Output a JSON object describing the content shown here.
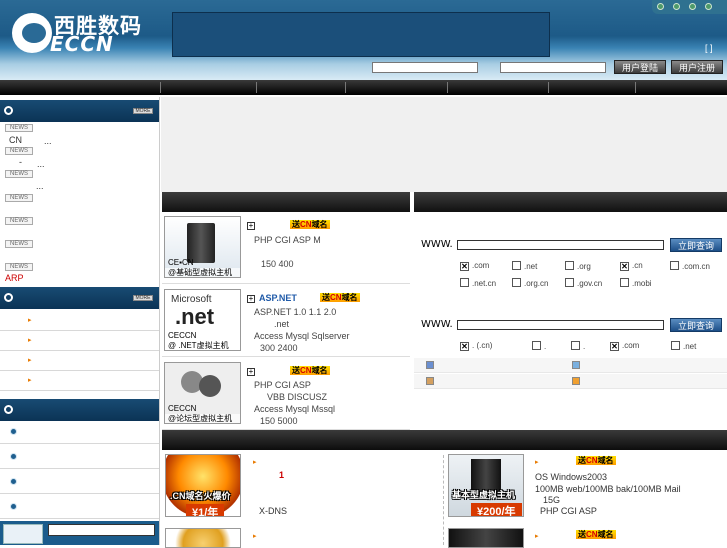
{
  "header": {
    "logo_cn": "西胜数码",
    "logo_en": "ECCN",
    "bracket_text": "[ ]",
    "login_button": "用户登陆",
    "register_button": "用户注册"
  },
  "sidebar": {
    "news_tag": "NEWS",
    "more_tag": "MORE",
    "news_lines": [
      "CN",
      "...",
      "-",
      "...",
      "...",
      "ARP"
    ]
  },
  "hosting": {
    "send_prefix": "送",
    "send_cn": "CN",
    "send_suffix": "域名",
    "items": [
      {
        "caption1": "CE▪CN",
        "caption2": "@基础型虚拟主机",
        "line1": "PHP CGI ASP  M",
        "line2": "150 400"
      },
      {
        "title": "ASP.NET",
        "caption1": "CECCN",
        "caption2": "@ .NET虚拟主机",
        "net_logo": "Microsoft",
        "net_big": ".net",
        "line1": "ASP.NET 1.0 1.1 2.0",
        "line2": ".net",
        "line3": "Access Mysql Sqlserver",
        "line4": "300 2400"
      },
      {
        "caption1": "CECCN",
        "caption2": "@论坛型虚拟主机",
        "line1": "PHP CGI ASP",
        "line2": "VBB DISCUSZ",
        "line3": "Access Mysql Mssql",
        "line4": "150 5000"
      }
    ]
  },
  "domain": {
    "www_label": "WWW.",
    "query_button": "立即查询",
    "tlds_row1": [
      {
        "label": ".com",
        "checked": true
      },
      {
        "label": ".net",
        "checked": false
      },
      {
        "label": ".org",
        "checked": false
      },
      {
        "label": ".cn",
        "checked": true
      },
      {
        "label": ".com.cn",
        "checked": false
      }
    ],
    "tlds_row2": [
      {
        "label": ".net.cn",
        "checked": false
      },
      {
        "label": ".org.cn",
        "checked": false
      },
      {
        "label": ".gov.cn",
        "checked": false
      },
      {
        "label": ".mobi",
        "checked": false
      }
    ],
    "tlds_row3": [
      {
        "label": ". (.cn)",
        "checked": true
      },
      {
        "label": ".",
        "checked": false
      },
      {
        "label": ".",
        "checked": false
      },
      {
        "label": ".com",
        "checked": true
      },
      {
        "label": ".net",
        "checked": false
      }
    ]
  },
  "lower": {
    "promo1_label": ".CN域名火爆价",
    "promo1_price": "¥1/年",
    "promo1_num": "1",
    "promo1_text": "X-DNS",
    "promo2_label": "基本型虚拟主机",
    "promo2_price": "¥200/年",
    "promo2_lines": [
      "OS Windows2003",
      "100MB web/100MB bak/100MB Mail",
      "15G",
      "PHP CGI ASP"
    ]
  }
}
